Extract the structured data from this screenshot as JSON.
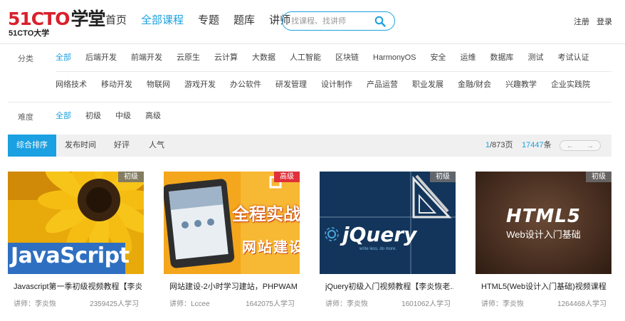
{
  "logo": {
    "main_red": "51CTO",
    "main_dark": "学堂",
    "sub": "51CTO大学"
  },
  "nav": {
    "items": [
      {
        "label": "首页",
        "active": false
      },
      {
        "label": "全部课程",
        "active": true
      },
      {
        "label": "专题",
        "active": false
      },
      {
        "label": "题库",
        "active": false
      },
      {
        "label": "讲师",
        "active": false
      }
    ]
  },
  "search": {
    "placeholder": "找课程、找讲师",
    "value": "",
    "icon": "search-icon"
  },
  "auth": {
    "register": "注册",
    "login": "登录"
  },
  "filters": {
    "category_label": "分类",
    "category_row1": [
      "全部",
      "后端开发",
      "前端开发",
      "云原生",
      "云计算",
      "大数据",
      "人工智能",
      "区块链",
      "HarmonyOS",
      "安全",
      "运维",
      "数据库",
      "测试",
      "考试认证"
    ],
    "category_row2": [
      "网络技术",
      "移动开发",
      "物联网",
      "游戏开发",
      "办公软件",
      "研发管理",
      "设计制作",
      "产品运营",
      "职业发展",
      "金融/财会",
      "兴趣教学",
      "企业实践院"
    ],
    "category_active": "全部",
    "difficulty_label": "难度",
    "difficulty": [
      "全部",
      "初级",
      "中级",
      "高级"
    ],
    "difficulty_active": "全部"
  },
  "sortbar": {
    "tabs": [
      {
        "label": "综合排序",
        "active": true
      },
      {
        "label": "发布时间",
        "active": false
      },
      {
        "label": "好评",
        "active": false
      },
      {
        "label": "人气",
        "active": false
      }
    ],
    "page_current": "1",
    "page_total": "/873页",
    "count_value": "17447",
    "count_unit": "条",
    "prev": "←",
    "next": "→"
  },
  "courses": [
    {
      "badge": "初级",
      "thumb_text": "JavaScript",
      "title": "Javascript第一季初级视频教程【李炎...",
      "teacher": "讲师：李炎恢",
      "learners": "2359425人学习"
    },
    {
      "badge": "高级",
      "thumb_text": "全程实战",
      "thumb_text2": "网站建设",
      "title": "网站建设-2小时学习建站，PHPWAM...",
      "teacher": "讲师：Lccee",
      "learners": "1642075人学习"
    },
    {
      "badge": "初级",
      "thumb_text": "jQuery",
      "thumb_text2": "write less, do more.",
      "title": "jQuery初级入门视频教程【李炎恢老...",
      "teacher": "讲师：李炎恢",
      "learners": "1601062人学习"
    },
    {
      "badge": "初级",
      "thumb_text": "HTML5",
      "thumb_text2": "Web设计入门基础",
      "title": "HTML5(Web设计入门基础)视频课程",
      "teacher": "讲师：李炎恢",
      "learners": "1264468人学习"
    }
  ],
  "colors": {
    "accent": "#1ba0e1",
    "brand_red": "#d9202c",
    "badge_red": "#e0313b"
  }
}
